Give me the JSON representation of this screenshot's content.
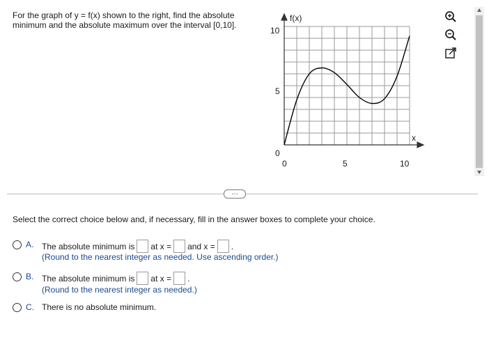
{
  "question": "For the graph of y = f(x) shown to the right, find the absolute minimum and the absolute maximum over the interval [0,10].",
  "graph": {
    "ylabel": "f(x)",
    "xlabel": "x",
    "y_ticks": [
      "10",
      "5",
      "0"
    ],
    "x_ticks": [
      "0",
      "5",
      "10"
    ],
    "xlim": [
      0,
      10
    ],
    "ylim": [
      0,
      10
    ],
    "curve": [
      [
        0,
        0
      ],
      [
        1,
        3.8
      ],
      [
        2,
        6
      ],
      [
        3,
        6.5
      ],
      [
        4,
        6.1
      ],
      [
        5,
        5.1
      ],
      [
        6,
        4.0
      ],
      [
        7,
        3.5
      ],
      [
        8,
        3.9
      ],
      [
        9,
        5.8
      ],
      [
        10,
        9.2
      ]
    ]
  },
  "toolbar": {
    "zoom_in": "zoom-in-icon",
    "zoom_out": "zoom-out-icon",
    "popout": "popout-icon"
  },
  "expander_label": "…",
  "instructions": "Select the correct choice below and, if necessary, fill in the answer boxes to complete your choice.",
  "choices": {
    "a": {
      "letter": "A.",
      "text1": "The absolute minimum is",
      "text2": "at x =",
      "text3": "and x =",
      "period": ".",
      "hint": "(Round to the nearest integer as needed. Use ascending order.)"
    },
    "b": {
      "letter": "B.",
      "text1": "The absolute minimum is",
      "text2": "at x =",
      "period": ".",
      "hint": "(Round to the nearest integer as needed.)"
    },
    "c": {
      "letter": "C.",
      "text1": "There is no absolute minimum."
    }
  }
}
